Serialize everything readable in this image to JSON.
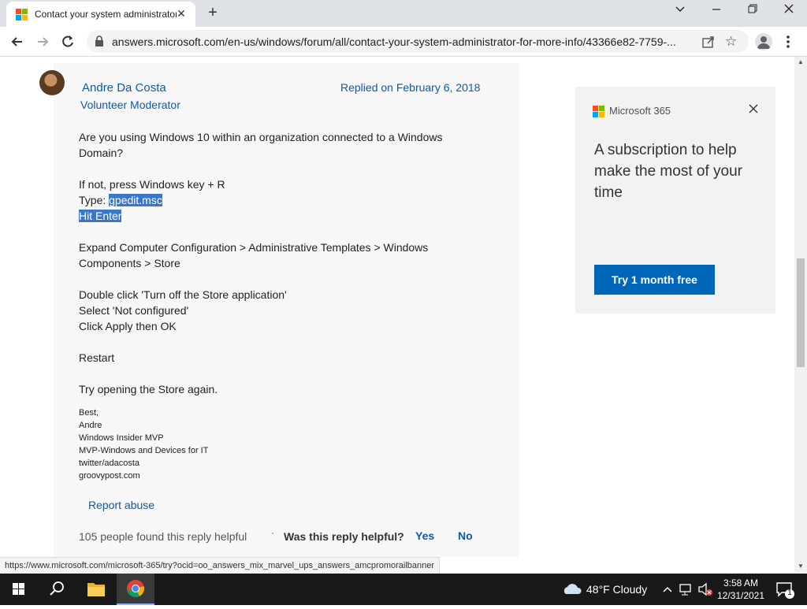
{
  "browser": {
    "tab_title": "Contact your system administrator",
    "url": "answers.microsoft.com/en-us/windows/forum/all/contact-your-system-administrator-for-more-info/43366e82-7759-..."
  },
  "post": {
    "author": "Andre Da Costa",
    "role": "Volunteer Moderator",
    "replied": "Replied on February 6, 2018",
    "body": {
      "line1": "Are you using Windows 10 within an organization connected to a Windows Domain?",
      "line2": "If not, press Windows key + R",
      "type_prefix": "Type: ",
      "type_value": "gpedit.msc",
      "hit_enter": "Hit Enter",
      "line3": "Expand Computer Configuration > Administrative Templates > Windows Components > Store",
      "line4": "Double click 'Turn off the Store application'",
      "line5": "Select 'Not configured'",
      "line6": "Click Apply then OK",
      "line7": "Restart",
      "line8": "Try opening the Store again."
    },
    "signature": [
      "Best,",
      "Andre",
      "Windows Insider MVP",
      "MVP-Windows and Devices for IT",
      "twitter/adacosta",
      "groovypost.com"
    ],
    "report_abuse": "Report abuse",
    "helpful_count": "105 people found this reply helpful",
    "helpful_question": "Was this reply helpful?",
    "yes": "Yes",
    "no": "No"
  },
  "ad": {
    "brand": "Microsoft 365",
    "headline": "A subscription to help make the most of your time",
    "cta": "Try 1 month free"
  },
  "status_url": "https://www.microsoft.com/microsoft-365/try?ocid=oo_answers_mix_marvel_ups_answers_amcpromorailbanner",
  "taskbar": {
    "weather": "48°F  Cloudy",
    "time": "3:58 AM",
    "date": "12/31/2021",
    "notification_count": "1"
  },
  "colors": {
    "link": "#0e5aa7",
    "selection": "#3a76c9",
    "cta": "#0067b8",
    "taskbar": "#191919"
  },
  "icons": [
    "microsoft-favicon",
    "close-icon",
    "plus-icon",
    "chevron-down-icon",
    "minimize-icon",
    "restore-icon",
    "back-icon",
    "forward-icon",
    "reload-icon",
    "lock-icon",
    "share-icon",
    "star-icon",
    "profile-icon",
    "kebab-menu-icon",
    "windows-start-icon",
    "search-icon",
    "file-explorer-icon",
    "chrome-icon",
    "cloud-icon",
    "caret-up-icon",
    "network-icon",
    "speaker-muted-icon",
    "notification-icon"
  ]
}
